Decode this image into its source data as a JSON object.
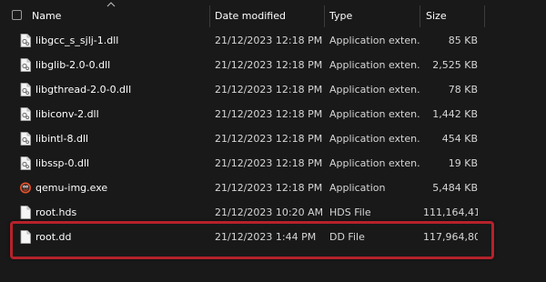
{
  "columns": {
    "name": "Name",
    "date_modified": "Date modified",
    "type": "Type",
    "size": "Size"
  },
  "sort": {
    "column": "name",
    "direction": "ascending"
  },
  "files": [
    {
      "name": "libgcc_s_sjlj-1.dll",
      "date": "21/12/2023 12:18 PM",
      "type": "Application exten...",
      "size": "85 KB",
      "icon": "dll-icon"
    },
    {
      "name": "libglib-2.0-0.dll",
      "date": "21/12/2023 12:18 PM",
      "type": "Application exten...",
      "size": "2,525 KB",
      "icon": "dll-icon"
    },
    {
      "name": "libgthread-2.0-0.dll",
      "date": "21/12/2023 12:18 PM",
      "type": "Application exten...",
      "size": "78 KB",
      "icon": "dll-icon"
    },
    {
      "name": "libiconv-2.dll",
      "date": "21/12/2023 12:18 PM",
      "type": "Application exten...",
      "size": "1,442 KB",
      "icon": "dll-icon"
    },
    {
      "name": "libintl-8.dll",
      "date": "21/12/2023 12:18 PM",
      "type": "Application exten...",
      "size": "454 KB",
      "icon": "dll-icon"
    },
    {
      "name": "libssp-0.dll",
      "date": "21/12/2023 12:18 PM",
      "type": "Application exten...",
      "size": "19 KB",
      "icon": "dll-icon"
    },
    {
      "name": "qemu-img.exe",
      "date": "21/12/2023 12:18 PM",
      "type": "Application",
      "size": "5,484 KB",
      "icon": "qemu-app-icon"
    },
    {
      "name": "root.hds",
      "date": "21/12/2023 10:20 AM",
      "type": "HDS File",
      "size": "111,164,41...",
      "icon": "blank-file-icon"
    },
    {
      "name": "root.dd",
      "date": "21/12/2023 1:44 PM",
      "type": "DD File",
      "size": "117,964,80...",
      "icon": "blank-file-icon"
    }
  ],
  "highlighted_file": "root.dd",
  "colors": {
    "background": "#191919",
    "highlight_border": "#b5222b",
    "text_primary": "#ffffff",
    "text_secondary": "#d6d6d6"
  }
}
